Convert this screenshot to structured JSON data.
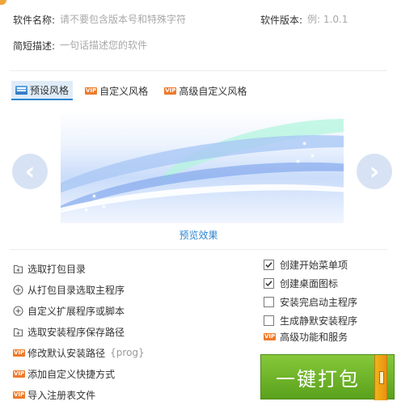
{
  "form": {
    "software_name_label": "软件名称:",
    "software_name_placeholder": "请不要包含版本号和特殊字符",
    "software_version_label": "软件版本:",
    "software_version_placeholder": "例: 1.0.1",
    "description_label": "简短描述:",
    "description_placeholder": "一句话描述您的软件"
  },
  "style_tabs": [
    {
      "label": "预设风格",
      "vip": false,
      "selected": true
    },
    {
      "label": "自定义风格",
      "vip": true,
      "selected": false
    },
    {
      "label": "高级自定义风格",
      "vip": true,
      "selected": false
    }
  ],
  "vip_badge": "VIP",
  "preview": {
    "caption": "预览效果",
    "prev_arrow": "‹",
    "next_arrow": "›"
  },
  "actions": [
    {
      "label": "选取打包目录",
      "icon": "folder-add-icon",
      "vip": false
    },
    {
      "label": "从打包目录选取主程序",
      "icon": "plus-circle-icon",
      "vip": false
    },
    {
      "label": "自定义扩展程序或脚本",
      "icon": "plus-circle-icon",
      "vip": false
    },
    {
      "label": "选取安装程序保存路径",
      "icon": "folder-add-icon",
      "vip": false
    },
    {
      "label": "修改默认安装路径",
      "icon": "vip-badge-icon",
      "vip": true,
      "hint": "{prog}"
    },
    {
      "label": "添加自定义快捷方式",
      "icon": "vip-badge-icon",
      "vip": true
    },
    {
      "label": "导入注册表文件",
      "icon": "vip-badge-icon",
      "vip": true
    }
  ],
  "options": [
    {
      "label": "创建开始菜单项",
      "checked": true
    },
    {
      "label": "创建桌面图标",
      "checked": true
    },
    {
      "label": "安装完启动主程序",
      "checked": false
    },
    {
      "label": "生成静默安装程序",
      "checked": false
    }
  ],
  "advanced": {
    "label": "高级功能和服务",
    "vip": true
  },
  "build_button": {
    "label": "一键打包"
  },
  "colors": {
    "accent_blue": "#2e86d1",
    "build_green": "#6fb52c",
    "vip_orange": "#ee7a2a",
    "handle_orange": "#f2b21a"
  }
}
